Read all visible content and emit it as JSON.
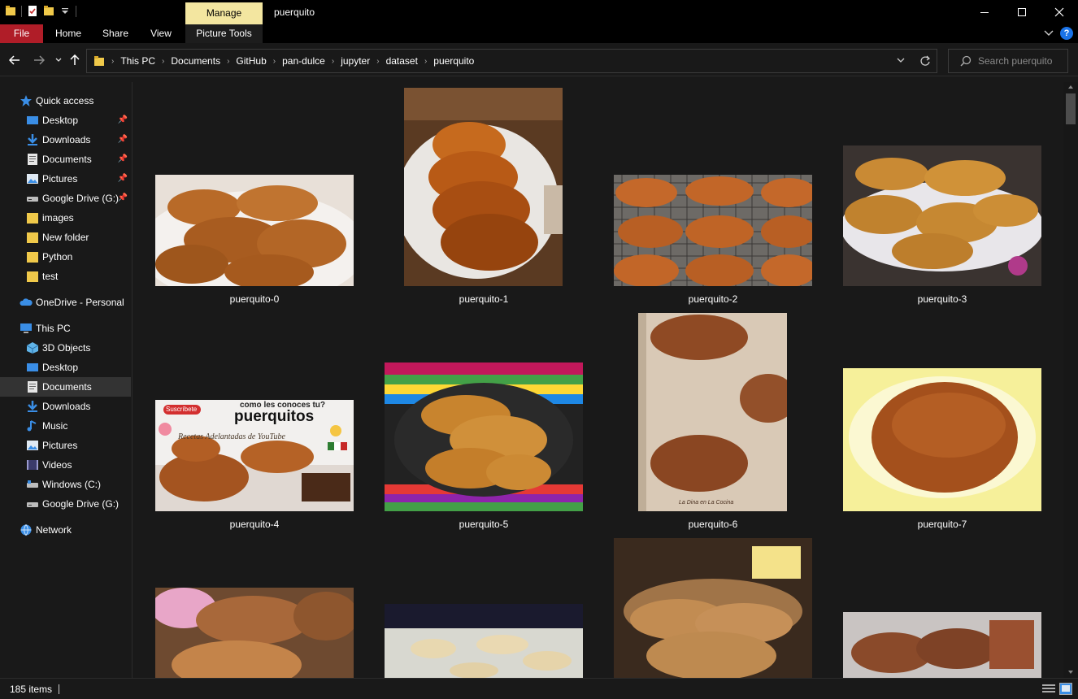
{
  "window": {
    "title": "puerquito",
    "manage_tab": "Manage",
    "controls": {
      "minimize": "minimize-icon",
      "maximize": "maximize-icon",
      "close": "close-icon"
    }
  },
  "ribbon": {
    "tabs": [
      {
        "label": "File"
      },
      {
        "label": "Home"
      },
      {
        "label": "Share"
      },
      {
        "label": "View"
      },
      {
        "label": "Picture Tools"
      }
    ],
    "help_label": "?"
  },
  "address": {
    "crumbs": [
      "This PC",
      "Documents",
      "GitHub",
      "pan-dulce",
      "jupyter",
      "dataset",
      "puerquito"
    ]
  },
  "search": {
    "placeholder": "Search puerquito"
  },
  "sidebar": {
    "items": [
      {
        "label": "Quick access",
        "icon": "star-icon"
      },
      {
        "label": "Desktop",
        "icon": "desktop-icon",
        "pinned": true
      },
      {
        "label": "Downloads",
        "icon": "download-icon",
        "pinned": true
      },
      {
        "label": "Documents",
        "icon": "document-icon",
        "pinned": true
      },
      {
        "label": "Pictures",
        "icon": "pictures-icon",
        "pinned": true
      },
      {
        "label": "Google Drive (G:)",
        "icon": "drive-icon",
        "pinned": true
      },
      {
        "label": "images",
        "icon": "folder-icon"
      },
      {
        "label": "New folder",
        "icon": "folder-icon"
      },
      {
        "label": "Python",
        "icon": "folder-icon"
      },
      {
        "label": "test",
        "icon": "folder-icon"
      },
      {
        "label": "OneDrive - Personal",
        "icon": "cloud-icon"
      },
      {
        "label": "This PC",
        "icon": "computer-icon"
      },
      {
        "label": "3D Objects",
        "icon": "cube-icon"
      },
      {
        "label": "Desktop",
        "icon": "desktop-icon"
      },
      {
        "label": "Documents",
        "icon": "document-icon",
        "selected": true
      },
      {
        "label": "Downloads",
        "icon": "download-icon"
      },
      {
        "label": "Music",
        "icon": "music-icon"
      },
      {
        "label": "Pictures",
        "icon": "pictures-icon"
      },
      {
        "label": "Videos",
        "icon": "video-icon"
      },
      {
        "label": "Windows (C:)",
        "icon": "drive-icon"
      },
      {
        "label": "Google Drive (G:)",
        "icon": "drive-icon"
      },
      {
        "label": "Network",
        "icon": "network-icon"
      }
    ]
  },
  "files": [
    {
      "name": "puerquito-0"
    },
    {
      "name": "puerquito-1"
    },
    {
      "name": "puerquito-2"
    },
    {
      "name": "puerquito-3"
    },
    {
      "name": "puerquito-4",
      "overlay": {
        "badge": "Suscríbete",
        "line1": "como les conoces tu?",
        "line2": "puerquitos",
        "line3": "Recetas Adelantadas de YouTube"
      }
    },
    {
      "name": "puerquito-5"
    },
    {
      "name": "puerquito-6",
      "watermark": "La Dina en La Cocina"
    },
    {
      "name": "puerquito-7"
    },
    {
      "name": ""
    },
    {
      "name": ""
    },
    {
      "name": ""
    },
    {
      "name": ""
    }
  ],
  "status": {
    "items_count": "185 items"
  },
  "colors": {
    "file_tab": "#b01d28",
    "manage_tab": "#f3e6a0",
    "background": "#191919",
    "accent": "#1a73e8"
  }
}
